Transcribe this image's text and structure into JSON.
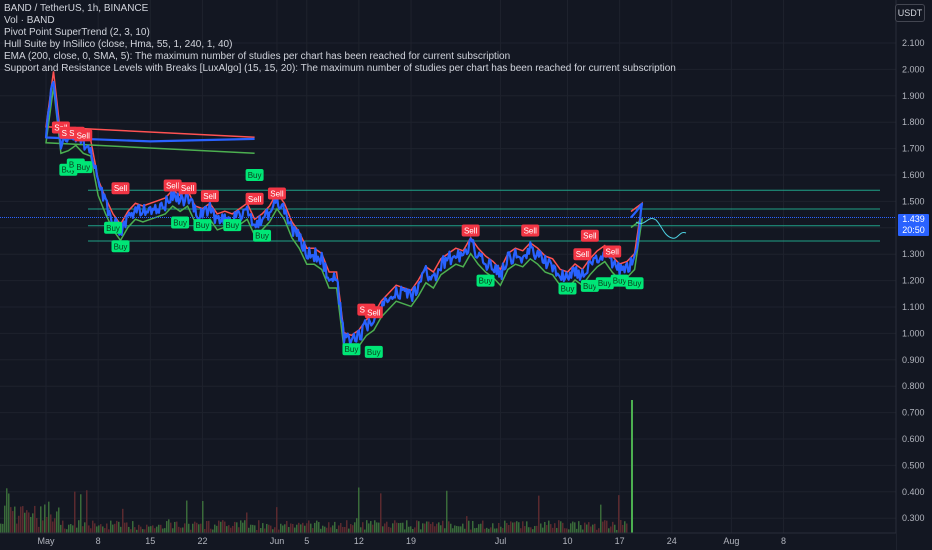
{
  "legend": {
    "symbol_line": "BAND / TetherUS, 1h, BINANCE",
    "vol_line": "Vol · BAND",
    "pivot_line": "Pivot Point SuperTrend (2, 3, 10)",
    "hull_line": "Hull Suite by InSilico (close, Hma, 55, 1, 240, 1, 40)",
    "ema_line": "EMA (200, close, 0, SMA, 5): The maximum number of studies per chart has been reached for current subscription",
    "sr_line": " Support and Resistance Levels with Breaks [LuxAlgo] (15, 15, 20): The maximum number of studies per chart has been reached for current subscription"
  },
  "currency_button": "USDT",
  "last_price": {
    "value": "1.439",
    "countdown": "20:50"
  },
  "colors": {
    "background": "#131722",
    "price_line": "#2962ff",
    "supertrend_up": "#4caf50",
    "supertrend_down": "#ff5252",
    "hull_up": "#00e676",
    "hull_down": "#ff5252",
    "sr_level": "#1fa187",
    "buy_label": "#00e676",
    "sell_label": "#f23645",
    "volume": "#3a6b3a"
  },
  "chart_data": {
    "type": "line",
    "title": "BAND / TetherUS, 1h, BINANCE",
    "y_axis_ticks": [
      "2.100",
      "2.000",
      "1.900",
      "1.800",
      "1.700",
      "1.600",
      "1.500",
      "1.400",
      "1.300",
      "1.200",
      "1.100",
      "1.000",
      "0.900",
      "0.800",
      "0.700",
      "0.600",
      "0.500",
      "0.400",
      "0.300"
    ],
    "x_axis_ticks": [
      "May",
      "8",
      "15",
      "22",
      "Jun",
      "5",
      "12",
      "19",
      "Jul",
      "10",
      "17",
      "24",
      "Aug",
      "8"
    ],
    "price_series": [
      {
        "x": "Apr 30",
        "y": 1.72
      },
      {
        "x": "May 1",
        "y": 1.76
      },
      {
        "x": "May 2",
        "y": 1.97
      },
      {
        "x": "May 3",
        "y": 1.72
      },
      {
        "x": "May 4",
        "y": 1.73
      },
      {
        "x": "May 5",
        "y": 1.75
      },
      {
        "x": "May 6",
        "y": 1.72
      },
      {
        "x": "May 7",
        "y": 1.71
      },
      {
        "x": "May 8",
        "y": 1.56
      },
      {
        "x": "May 9",
        "y": 1.49
      },
      {
        "x": "May 10",
        "y": 1.43
      },
      {
        "x": "May 11",
        "y": 1.39
      },
      {
        "x": "May 12",
        "y": 1.44
      },
      {
        "x": "May 13",
        "y": 1.47
      },
      {
        "x": "May 14",
        "y": 1.46
      },
      {
        "x": "May 15",
        "y": 1.47
      },
      {
        "x": "May 16",
        "y": 1.48
      },
      {
        "x": "May 17",
        "y": 1.49
      },
      {
        "x": "May 18",
        "y": 1.52
      },
      {
        "x": "May 19",
        "y": 1.5
      },
      {
        "x": "May 20",
        "y": 1.52
      },
      {
        "x": "May 21",
        "y": 1.46
      },
      {
        "x": "May 22",
        "y": 1.45
      },
      {
        "x": "May 23",
        "y": 1.47
      },
      {
        "x": "May 24",
        "y": 1.43
      },
      {
        "x": "May 25",
        "y": 1.44
      },
      {
        "x": "May 26",
        "y": 1.43
      },
      {
        "x": "May 27",
        "y": 1.45
      },
      {
        "x": "May 28",
        "y": 1.47
      },
      {
        "x": "May 29",
        "y": 1.41
      },
      {
        "x": "May 30",
        "y": 1.43
      },
      {
        "x": "May 31",
        "y": 1.46
      },
      {
        "x": "Jun 1",
        "y": 1.51
      },
      {
        "x": "Jun 2",
        "y": 1.47
      },
      {
        "x": "Jun 3",
        "y": 1.4
      },
      {
        "x": "Jun 4",
        "y": 1.36
      },
      {
        "x": "Jun 5",
        "y": 1.3
      },
      {
        "x": "Jun 6",
        "y": 1.3
      },
      {
        "x": "Jun 7",
        "y": 1.28
      },
      {
        "x": "Jun 8",
        "y": 1.21
      },
      {
        "x": "Jun 9",
        "y": 1.21
      },
      {
        "x": "Jun 10",
        "y": 0.98
      },
      {
        "x": "Jun 11",
        "y": 0.97
      },
      {
        "x": "Jun 12",
        "y": 0.99
      },
      {
        "x": "Jun 13",
        "y": 1.03
      },
      {
        "x": "Jun 14",
        "y": 1.05
      },
      {
        "x": "Jun 15",
        "y": 1.1
      },
      {
        "x": "Jun 16",
        "y": 1.13
      },
      {
        "x": "Jun 17",
        "y": 1.16
      },
      {
        "x": "Jun 18",
        "y": 1.15
      },
      {
        "x": "Jun 19",
        "y": 1.14
      },
      {
        "x": "Jun 20",
        "y": 1.18
      },
      {
        "x": "Jun 21",
        "y": 1.23
      },
      {
        "x": "Jun 22",
        "y": 1.21
      },
      {
        "x": "Jun 23",
        "y": 1.26
      },
      {
        "x": "Jun 24",
        "y": 1.28
      },
      {
        "x": "Jun 25",
        "y": 1.3
      },
      {
        "x": "Jun 26",
        "y": 1.29
      },
      {
        "x": "Jun 27",
        "y": 1.34
      },
      {
        "x": "Jun 28",
        "y": 1.3
      },
      {
        "x": "Jun 29",
        "y": 1.27
      },
      {
        "x": "Jun 30",
        "y": 1.25
      },
      {
        "x": "Jul 1",
        "y": 1.22
      },
      {
        "x": "Jul 2",
        "y": 1.28
      },
      {
        "x": "Jul 3",
        "y": 1.3
      },
      {
        "x": "Jul 4",
        "y": 1.29
      },
      {
        "x": "Jul 5",
        "y": 1.32
      },
      {
        "x": "Jul 6",
        "y": 1.3
      },
      {
        "x": "Jul 7",
        "y": 1.27
      },
      {
        "x": "Jul 8",
        "y": 1.26
      },
      {
        "x": "Jul 9",
        "y": 1.22
      },
      {
        "x": "Jul 10",
        "y": 1.21
      },
      {
        "x": "Jul 11",
        "y": 1.24
      },
      {
        "x": "Jul 12",
        "y": 1.22
      },
      {
        "x": "Jul 13",
        "y": 1.26
      },
      {
        "x": "Jul 14",
        "y": 1.29
      },
      {
        "x": "Jul 15",
        "y": 1.31
      },
      {
        "x": "Jul 16",
        "y": 1.27
      },
      {
        "x": "Jul 17",
        "y": 1.24
      },
      {
        "x": "Jul 18",
        "y": 1.25
      },
      {
        "x": "Jul 19",
        "y": 1.28
      },
      {
        "x": "Jul 20",
        "y": 1.47
      },
      {
        "x": "Jul 20 (last)",
        "y": 1.439
      }
    ],
    "sr_levels": [
      1.542,
      1.471,
      1.408,
      1.35
    ],
    "signals": [
      {
        "label": "Buy",
        "x": "Apr 30",
        "y": 1.6
      },
      {
        "label": "Sell",
        "x": "May 3",
        "y": 1.78
      },
      {
        "label": "Sell",
        "x": "May 4",
        "y": 1.76
      },
      {
        "label": "Sell",
        "x": "May 5",
        "y": 1.76
      },
      {
        "label": "Sell",
        "x": "May 6",
        "y": 1.75
      },
      {
        "label": "Buy",
        "x": "May 4",
        "y": 1.62
      },
      {
        "label": "Buy",
        "x": "May 5",
        "y": 1.64
      },
      {
        "label": "Buy",
        "x": "May 6",
        "y": 1.63
      },
      {
        "label": "Sell",
        "x": "May 11",
        "y": 1.55
      },
      {
        "label": "Buy",
        "x": "May 10",
        "y": 1.4
      },
      {
        "label": "Buy",
        "x": "May 11",
        "y": 1.33
      },
      {
        "label": "Sell",
        "x": "May 18",
        "y": 1.56
      },
      {
        "label": "Sell",
        "x": "May 20",
        "y": 1.55
      },
      {
        "label": "Buy",
        "x": "May 19",
        "y": 1.42
      },
      {
        "label": "Sell",
        "x": "May 23",
        "y": 1.52
      },
      {
        "label": "Buy",
        "x": "May 22",
        "y": 1.41
      },
      {
        "label": "Buy",
        "x": "May 26",
        "y": 1.41
      },
      {
        "label": "Sell",
        "x": "May 29",
        "y": 1.51
      },
      {
        "label": "Buy",
        "x": "May 30",
        "y": 1.37
      },
      {
        "label": "Sell",
        "x": "Jun 1",
        "y": 1.53
      },
      {
        "label": "Sell",
        "x": "Jun 13",
        "y": 1.09
      },
      {
        "label": "Sell",
        "x": "Jun 14",
        "y": 1.08
      },
      {
        "label": "Buy",
        "x": "Jun 11",
        "y": 0.94
      },
      {
        "label": "Buy",
        "x": "Jun 14",
        "y": 0.93
      },
      {
        "label": "Sell",
        "x": "Jun 27",
        "y": 1.39
      },
      {
        "label": "Buy",
        "x": "Jun 29",
        "y": 1.2
      },
      {
        "label": "Sell",
        "x": "Jul 5",
        "y": 1.39
      },
      {
        "label": "Buy",
        "x": "Jul 10",
        "y": 1.17
      },
      {
        "label": "Sell",
        "x": "Jul 13",
        "y": 1.37
      },
      {
        "label": "Sell",
        "x": "Jul 12",
        "y": 1.3
      },
      {
        "label": "Buy",
        "x": "Jul 13",
        "y": 1.18
      },
      {
        "label": "Buy",
        "x": "Jul 15",
        "y": 1.19
      },
      {
        "label": "Sell",
        "x": "Jul 16",
        "y": 1.31
      },
      {
        "label": "Buy",
        "x": "Jul 17",
        "y": 1.2
      },
      {
        "label": "Buy",
        "x": "Jul 19",
        "y": 1.19
      }
    ]
  }
}
